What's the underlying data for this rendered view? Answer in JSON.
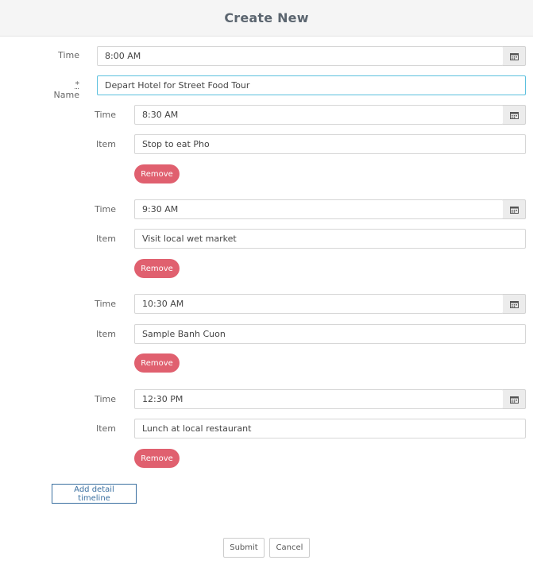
{
  "header": {
    "title": "Create New"
  },
  "form": {
    "time_label": "Time",
    "time_value": "8:00 AM",
    "name_required_mark": "*",
    "name_label": "Name",
    "name_value": "Depart Hotel for Street Food Tour"
  },
  "details": [
    {
      "time_label": "Time",
      "time_value": "8:30 AM",
      "item_label": "Item",
      "item_value": "Stop to eat Pho",
      "remove_label": "Remove"
    },
    {
      "time_label": "Time",
      "time_value": "9:30 AM",
      "item_label": "Item",
      "item_value": "Visit local wet market",
      "remove_label": "Remove"
    },
    {
      "time_label": "Time",
      "time_value": "10:30 AM",
      "item_label": "Item",
      "item_value": "Sample Banh Cuon",
      "remove_label": "Remove"
    },
    {
      "time_label": "Time",
      "time_value": "12:30 PM",
      "item_label": "Item",
      "item_value": "Lunch at local restaurant",
      "remove_label": "Remove"
    }
  ],
  "actions": {
    "add_detail_label": "Add detail timeline",
    "submit_label": "Submit",
    "cancel_label": "Cancel"
  },
  "icons": {
    "calendar": "calendar-icon"
  },
  "colors": {
    "remove_button": "#e0606f",
    "add_button_border": "#3a6fa0",
    "focus_border": "#5bc0de",
    "header_bg": "#f5f5f5"
  }
}
